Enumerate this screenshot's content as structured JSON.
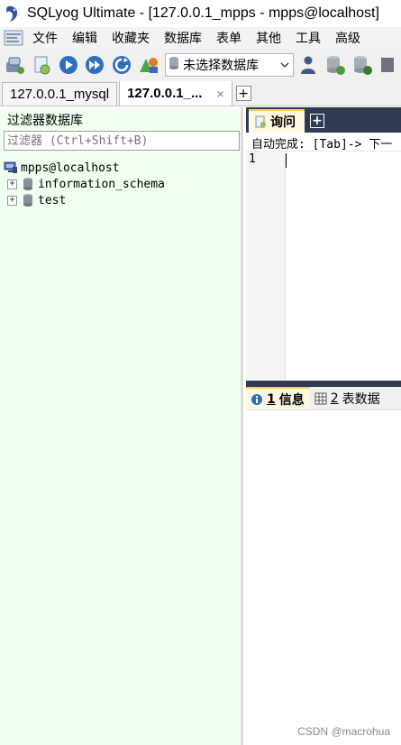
{
  "window": {
    "title": "SQLyog Ultimate - [127.0.0.1_mpps - mpps@localhost]"
  },
  "menu": {
    "items": [
      "文件",
      "编辑",
      "收藏夹",
      "数据库",
      "表单",
      "其他",
      "工具",
      "高级"
    ]
  },
  "toolbar": {
    "db_selector_value": "未选择数据库"
  },
  "connection_tabs": [
    {
      "label": "127.0.0.1_mysql"
    },
    {
      "label": "127.0.0.1_...",
      "close": "×"
    }
  ],
  "object_browser": {
    "title": "过滤器数据库",
    "filter_placeholder": "过滤器 (Ctrl+Shift+B)",
    "host": "mpps@localhost",
    "databases": [
      "information_schema",
      "test"
    ]
  },
  "query": {
    "tab_label": "询问",
    "autocomplete_hint": "自动完成: [Tab]-> 下一",
    "line_number": "1"
  },
  "results": {
    "tabs": [
      {
        "num": "1",
        "label": "信息"
      },
      {
        "num": "2",
        "label": "表数据"
      }
    ]
  },
  "watermark": "CSDN @macrohua",
  "colors": {
    "left_pane_bg": "#f0fff0",
    "query_header_bg": "#2e3b53",
    "active_tab_bg": "#fff8e0"
  }
}
